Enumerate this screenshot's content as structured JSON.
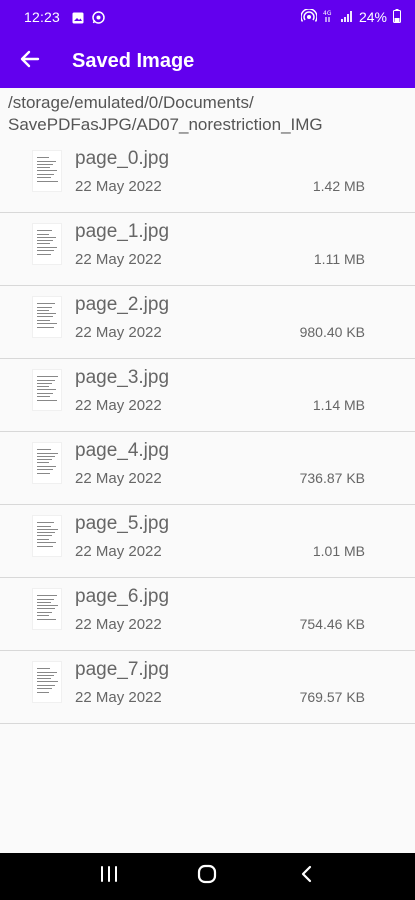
{
  "status_bar": {
    "time": "12:23",
    "battery": "24%",
    "icons_left": [
      "gallery-icon",
      "whatsapp-icon"
    ],
    "icons_right": [
      "hotspot-icon",
      "network-4g-icon",
      "signal-icon",
      "battery-icon"
    ]
  },
  "app_bar": {
    "title": "Saved Image",
    "back_icon": "arrow-left-icon"
  },
  "path": "/storage/emulated/0/Documents/\nSavePDFasJPG/AD07_norestriction_IMG",
  "files": [
    {
      "name": "page_0.jpg",
      "date": "22 May 2022",
      "size": "1.42 MB"
    },
    {
      "name": "page_1.jpg",
      "date": "22 May 2022",
      "size": "1.11 MB"
    },
    {
      "name": "page_2.jpg",
      "date": "22 May 2022",
      "size": "980.40 KB"
    },
    {
      "name": "page_3.jpg",
      "date": "22 May 2022",
      "size": "1.14 MB"
    },
    {
      "name": "page_4.jpg",
      "date": "22 May 2022",
      "size": "736.87 KB"
    },
    {
      "name": "page_5.jpg",
      "date": "22 May 2022",
      "size": "1.01 MB"
    },
    {
      "name": "page_6.jpg",
      "date": "22 May 2022",
      "size": "754.46 KB"
    },
    {
      "name": "page_7.jpg",
      "date": "22 May 2022",
      "size": "769.57 KB"
    }
  ],
  "nav_bar": {
    "icons": [
      "recents-icon",
      "home-icon",
      "back-icon"
    ]
  },
  "colors": {
    "primary": "#6200ee",
    "background": "#fafafa",
    "divider": "#d8d8d8",
    "text": "#666666"
  }
}
